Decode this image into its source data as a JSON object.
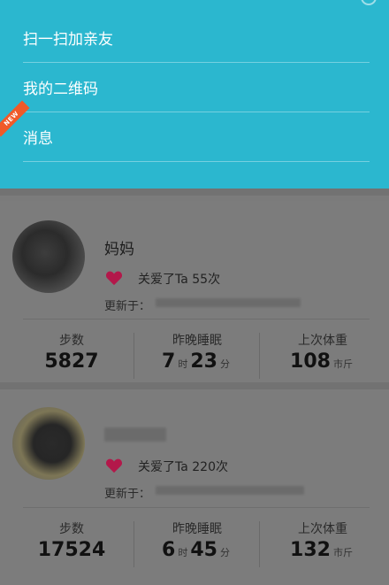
{
  "menu": {
    "items": [
      {
        "label": "扫一扫加亲友"
      },
      {
        "label": "我的二维码"
      },
      {
        "label": "消息"
      }
    ],
    "new_badge": "NEW"
  },
  "family": [
    {
      "name": "妈妈",
      "love_text": "关爱了Ta 55次",
      "updated_label": "更新于：",
      "stats": {
        "steps_label": "步数",
        "steps": "5827",
        "sleep_label": "昨晚睡眠",
        "sleep_h": "7",
        "sleep_h_unit": "时",
        "sleep_m": "23",
        "sleep_m_unit": "分",
        "weight_label": "上次体重",
        "weight": "108",
        "weight_unit": "市斤"
      }
    },
    {
      "name": "",
      "love_text": "关爱了Ta 220次",
      "updated_label": "更新于：",
      "stats": {
        "steps_label": "步数",
        "steps": "17524",
        "sleep_label": "昨晚睡眠",
        "sleep_h": "6",
        "sleep_h_unit": "时",
        "sleep_m": "45",
        "sleep_m_unit": "分",
        "weight_label": "上次体重",
        "weight": "132",
        "weight_unit": "市斤"
      }
    }
  ],
  "colors": {
    "menu_bg": "#2bb7cf",
    "heart": "#c4174a",
    "new_badge": "#f05a28"
  }
}
